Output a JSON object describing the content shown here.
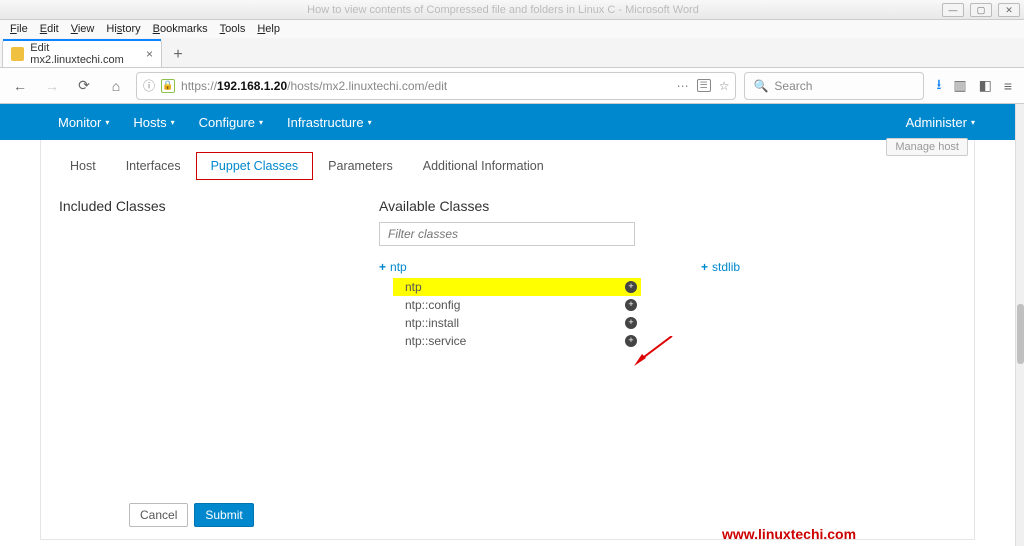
{
  "window": {
    "faint_title": "How to view contents of Compressed file and folders in Linux C - Microsoft Word"
  },
  "browser_menu": {
    "file": "File",
    "edit": "Edit",
    "view": "View",
    "history": "History",
    "bookmarks": "Bookmarks",
    "tools": "Tools",
    "help": "Help"
  },
  "tab": {
    "label": "Edit mx2.linuxtechi.com",
    "close": "×",
    "add": "+"
  },
  "toolbar": {
    "url_prefix": "https://",
    "url_host": "192.168.1.20",
    "url_path": "/hosts/mx2.linuxtechi.com/edit",
    "search_placeholder": "Search"
  },
  "foreman_nav": {
    "monitor": "Monitor",
    "hosts": "Hosts",
    "configure": "Configure",
    "infrastructure": "Infrastructure",
    "administer": "Administer"
  },
  "manage_host_stub": "Manage host",
  "page_tabs": {
    "host": "Host",
    "interfaces": "Interfaces",
    "puppet_classes": "Puppet Classes",
    "parameters": "Parameters",
    "additional": "Additional Information"
  },
  "included": {
    "title": "Included Classes"
  },
  "available": {
    "title": "Available Classes",
    "filter_placeholder": "Filter classes",
    "groups": {
      "ntp": "ntp",
      "stdlib": "stdlib"
    },
    "ntp_children": [
      "ntp",
      "ntp::config",
      "ntp::install",
      "ntp::service"
    ]
  },
  "buttons": {
    "cancel": "Cancel",
    "submit": "Submit"
  },
  "watermark": "www.linuxtechi.com"
}
